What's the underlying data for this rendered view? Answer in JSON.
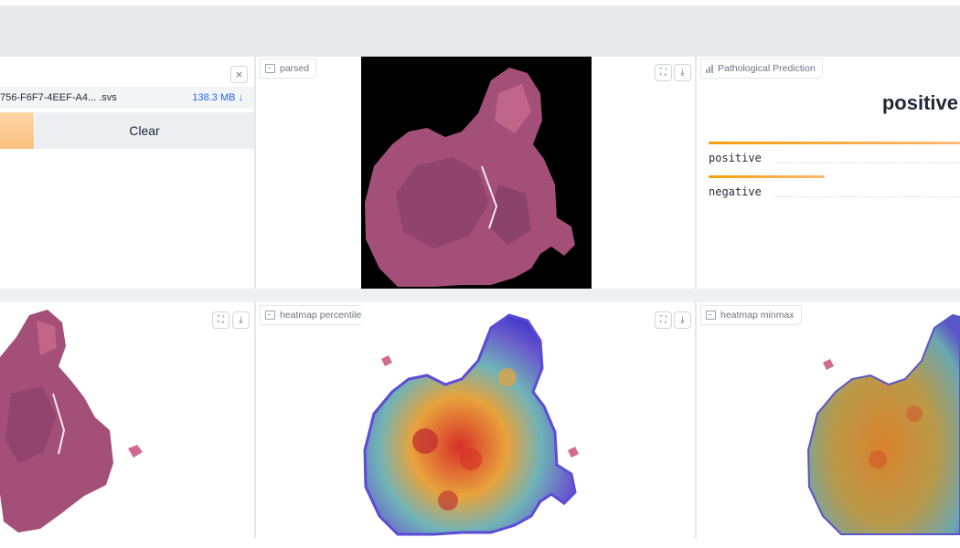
{
  "upload": {
    "file_name": "756-F6F7-4EEF-A4... .svs",
    "file_size": "138.3 MB ↓",
    "clear_label": "Clear",
    "close_icon": "×"
  },
  "panels": {
    "parsed": {
      "label": "parsed"
    },
    "prediction": {
      "label": "Pathological Prediction"
    },
    "heatmap_percentile": {
      "label": "heatmap percentile"
    },
    "heatmap_minmax": {
      "label": "heatmap minmax"
    }
  },
  "prediction": {
    "top_label": "positive",
    "labels": [
      {
        "name": "positive",
        "confidence": 1.0
      },
      {
        "name": "negative",
        "confidence": 0.46
      }
    ]
  },
  "icons": {
    "fullscreen": "⛶",
    "download": "⤓"
  },
  "colors": {
    "accent": "#f59e0b",
    "link": "#2563eb",
    "tissue": "#a34f78"
  }
}
